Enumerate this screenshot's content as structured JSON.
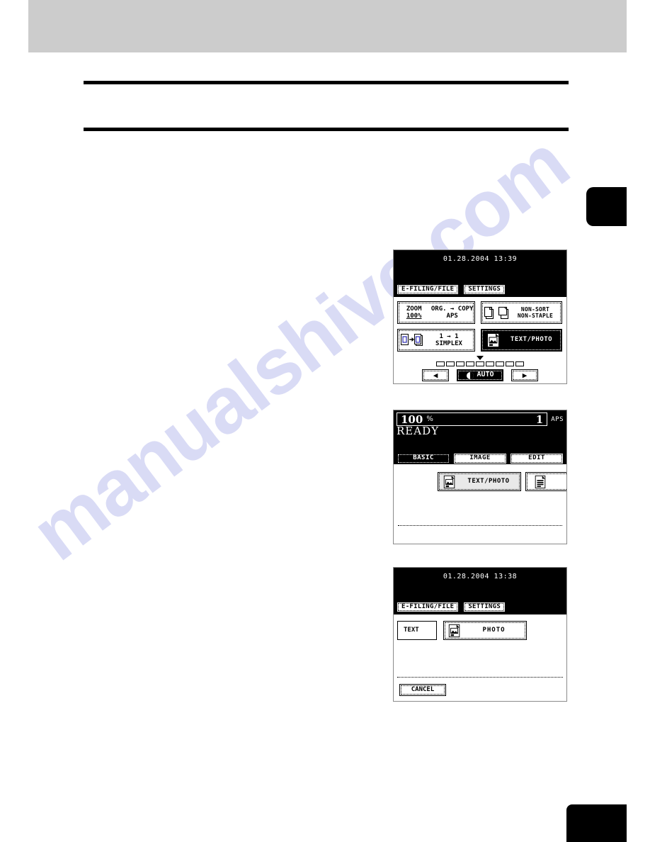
{
  "page": {
    "watermark": "manualshive.com"
  },
  "panel1": {
    "name": "copier-basic-screen",
    "clock": "01.28.2004 13:39",
    "tabs": [
      {
        "label": "E-FILING/FILE"
      },
      {
        "label": "SETTINGS"
      }
    ],
    "keys": {
      "zoom_label": "ZOOM",
      "zoom_value": "100%",
      "org_copy_label": "ORG. → COPY",
      "org_copy_value": "APS",
      "finisher_line1": "NON-SORT",
      "finisher_line2": "NON-STAPLE",
      "duplex_line1": "1 → 1",
      "duplex_line2": "SIMPLEX",
      "mode_label": "TEXT/PHOTO"
    },
    "density": {
      "segments": 9,
      "marker_index": 4,
      "left_arrow": "◀",
      "right_arrow": "▶",
      "auto_label": "AUTO"
    }
  },
  "panel2": {
    "name": "image-mode-screen",
    "ratio": "100",
    "percent": "%",
    "copy_count": "1",
    "paper": "APS",
    "status": "READY",
    "tabs": [
      {
        "label": "BASIC"
      },
      {
        "label": "IMAGE"
      },
      {
        "label": "EDIT"
      }
    ],
    "modes": [
      {
        "label": "TEXT/PHOTO"
      },
      {
        "label": ""
      }
    ]
  },
  "panel3": {
    "name": "original-mode-screen",
    "clock": "01.28.2004 13:38",
    "tabs": [
      {
        "label": "E-FILING/FILE"
      },
      {
        "label": "SETTINGS"
      }
    ],
    "options": [
      {
        "label": "TEXT"
      },
      {
        "label": "PHOTO"
      }
    ],
    "cancel_label": "CANCEL"
  },
  "colors": {
    "header_band": "#cccccc",
    "rule": "#000000",
    "lcd_background": "#000000",
    "lcd_foreground": "#ffffff",
    "watermark": "#c3c6ef"
  }
}
